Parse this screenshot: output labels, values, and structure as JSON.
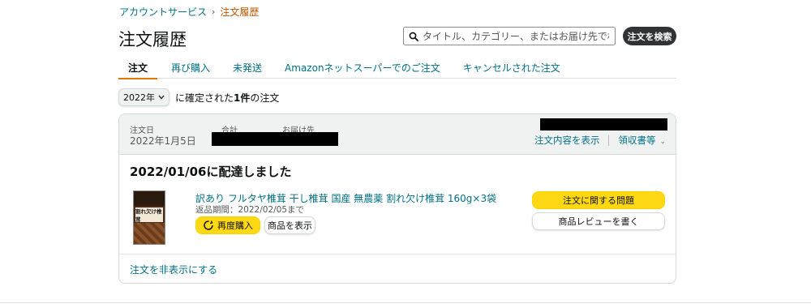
{
  "breadcrumb": {
    "parent": "アカウントサービス",
    "separator": "›",
    "current": "注文履歴"
  },
  "page_title": "注文履歴",
  "search": {
    "placeholder": "タイトル、カテゴリー、またはお届け先で検索",
    "value": "",
    "button_label": "注文を検索"
  },
  "tabs": [
    {
      "label": "注文",
      "active": true
    },
    {
      "label": "再び購入",
      "active": false
    },
    {
      "label": "未発送",
      "active": false
    },
    {
      "label": "Amazonネットスーパーでのご注文",
      "active": false
    },
    {
      "label": "キャンセルされた注文",
      "active": false
    }
  ],
  "filter": {
    "year": "2022年",
    "text_prefix": "に確定された",
    "count": "1件",
    "text_suffix": "の注文"
  },
  "order": {
    "date_label": "注文日",
    "date_value": "2022年1月5日",
    "total_label": "合計",
    "ship_to_label": "お届け先",
    "details_link": "注文内容を表示",
    "receipt_link": "領収書等",
    "delivery_status": "2022/01/06に配達しました",
    "product": {
      "title": "訳あり フルタヤ椎茸 干し椎茸 国産 無農薬 割れ欠け椎茸 160g×3袋",
      "image_text": "割れ欠け椎茸",
      "return_period": "返品期間：2022/02/05まで",
      "rebuy_label": "再度購入",
      "view_label": "商品を表示"
    },
    "problem_button": "注文に関する問題",
    "review_button": "商品レビューを書く",
    "hide_link": "注文を非表示にする"
  },
  "colors": {
    "link": "#007185",
    "accent": "#e77600",
    "breadcrumb_current": "#c45500",
    "primary_button": "#ffd814",
    "dark_button": "#303333"
  },
  "icons": {
    "search": "search-icon",
    "select_chevron": "chevron-down-icon",
    "receipt_chevron": "chevron-down-icon",
    "rebuy": "rebuy-icon"
  }
}
